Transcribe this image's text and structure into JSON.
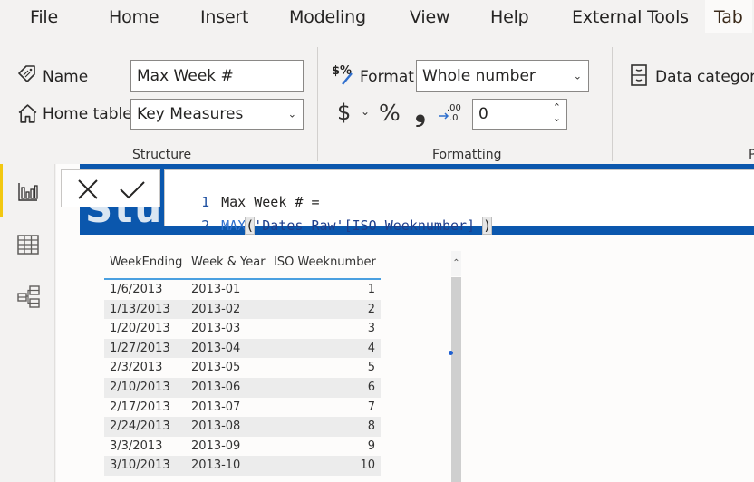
{
  "menu": {
    "tabs": [
      {
        "label": "File"
      },
      {
        "label": "Home"
      },
      {
        "label": "Insert"
      },
      {
        "label": "Modeling"
      },
      {
        "label": "View"
      },
      {
        "label": "Help"
      },
      {
        "label": "External Tools"
      },
      {
        "label": "Tab"
      }
    ],
    "active_index": 7
  },
  "ribbon": {
    "structure": {
      "group_label": "Structure",
      "name_label": "Name",
      "name_value": "Max Week #",
      "home_table_label": "Home table",
      "home_table_value": "Key Measures"
    },
    "formatting": {
      "group_label": "Formatting",
      "format_label": "Format",
      "format_value": "Whole number",
      "currency_symbol": "$",
      "percent_symbol": "%",
      "comma_symbol": "’",
      "decimals_value": "0"
    },
    "properties": {
      "data_category_label": "Data category",
      "group_label_partial": "P"
    }
  },
  "left_rail": {
    "items": [
      {
        "name": "report-view",
        "icon": "bar-chart-icon",
        "active": true
      },
      {
        "name": "data-view",
        "icon": "table-grid-icon",
        "active": false
      },
      {
        "name": "model-view",
        "icon": "model-icon",
        "active": false
      }
    ]
  },
  "formula_bar": {
    "line1_no": "1",
    "line1_code": "Max Week # =",
    "line2_no": "2",
    "line2_fn": "MAX",
    "line2_open": "(",
    "line2_ref": "'Dates Raw'[ISO Weeknumber] ",
    "line2_close": ")"
  },
  "banner": {
    "title_partial": "Stud"
  },
  "table": {
    "columns": [
      "WeekEnding",
      "Week & Year",
      "ISO Weeknumber"
    ],
    "rows": [
      [
        "1/6/2013",
        "2013-01",
        "1"
      ],
      [
        "1/13/2013",
        "2013-02",
        "2"
      ],
      [
        "1/20/2013",
        "2013-03",
        "3"
      ],
      [
        "1/27/2013",
        "2013-04",
        "4"
      ],
      [
        "2/3/2013",
        "2013-05",
        "5"
      ],
      [
        "2/10/2013",
        "2013-06",
        "6"
      ],
      [
        "2/17/2013",
        "2013-07",
        "7"
      ],
      [
        "2/24/2013",
        "2013-08",
        "8"
      ],
      [
        "3/3/2013",
        "2013-09",
        "9"
      ],
      [
        "3/10/2013",
        "2013-10",
        "10"
      ]
    ]
  },
  "colors": {
    "accent_blue": "#0b57ad",
    "rail_accent": "#f2c811",
    "table_header_line": "#4ba0e0"
  }
}
